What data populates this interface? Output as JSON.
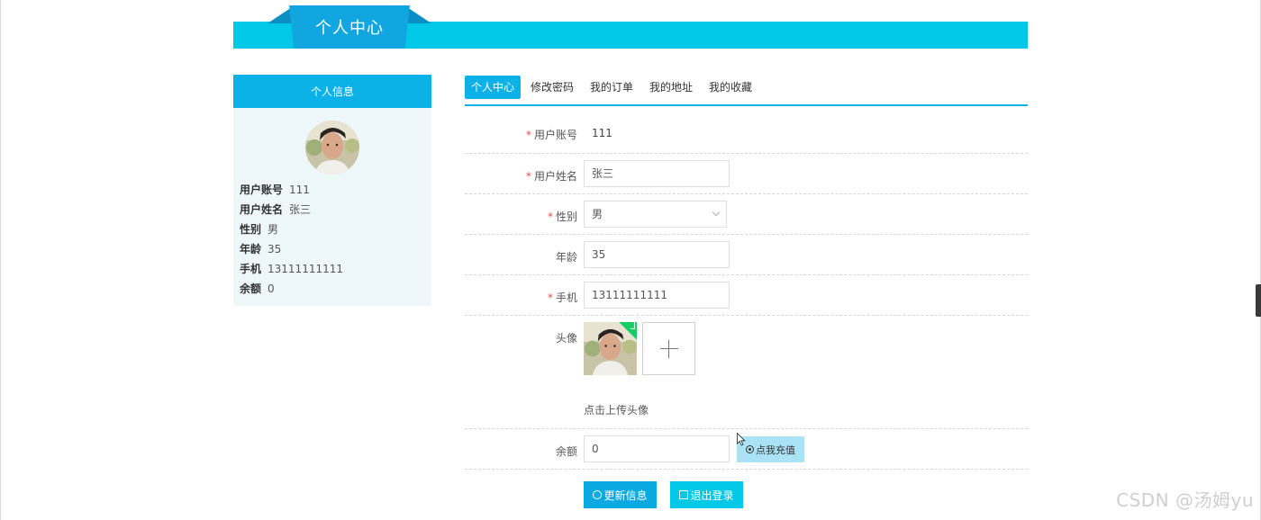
{
  "banner": {
    "title": "个人中心"
  },
  "sidebar": {
    "heading": "个人信息",
    "rows": [
      {
        "key": "用户账号",
        "value": "111"
      },
      {
        "key": "用户姓名",
        "value": "张三"
      },
      {
        "key": "性别",
        "value": "男"
      },
      {
        "key": "年龄",
        "value": "35"
      },
      {
        "key": "手机",
        "value": "13111111111"
      },
      {
        "key": "余额",
        "value": "0"
      }
    ]
  },
  "tabs": [
    {
      "label": "个人中心",
      "active": true
    },
    {
      "label": "修改密码",
      "active": false
    },
    {
      "label": "我的订单",
      "active": false
    },
    {
      "label": "我的地址",
      "active": false
    },
    {
      "label": "我的收藏",
      "active": false
    }
  ],
  "form": {
    "account": {
      "label": "用户账号",
      "value": "111",
      "required": true
    },
    "name": {
      "label": "用户姓名",
      "value": "张三",
      "required": true
    },
    "gender": {
      "label": "性别",
      "value": "男",
      "required": true
    },
    "age": {
      "label": "年龄",
      "value": "35",
      "required": false
    },
    "phone": {
      "label": "手机",
      "value": "13111111111",
      "required": true
    },
    "avatar": {
      "label": "头像",
      "hint": "点击上传头像"
    },
    "balance": {
      "label": "余额",
      "value": "0",
      "recharge_label": "点我充值"
    },
    "required_mark": "*"
  },
  "actions": {
    "update_label": "更新信息",
    "logout_label": "退出登录"
  },
  "watermark": "CSDN @汤姆yu",
  "colors": {
    "primary": "#0cb1e8",
    "banner": "#00c8e6",
    "success": "#13ce66",
    "required": "#e25050"
  }
}
